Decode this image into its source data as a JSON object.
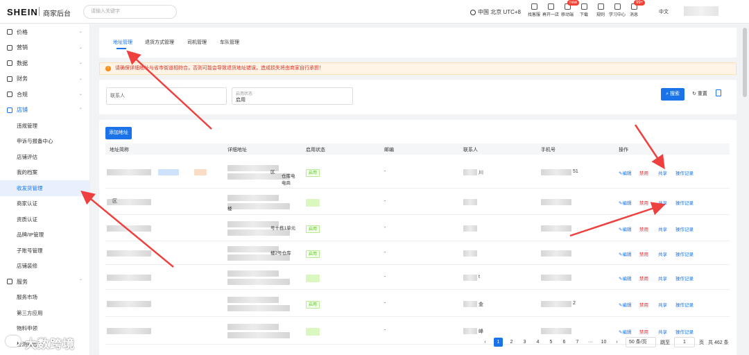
{
  "header": {
    "logo": "SHEIN",
    "subtitle": "商家后台",
    "search_placeholder": "请输入关键字",
    "region": "中国 北京 UTC+8",
    "tools": [
      {
        "label": "找客服",
        "badge": ""
      },
      {
        "label": "再开一店",
        "badge": ""
      },
      {
        "label": "移动端",
        "badge": "new"
      },
      {
        "label": "下载",
        "badge": ""
      },
      {
        "label": "规则",
        "badge": ""
      },
      {
        "label": "学习中心",
        "badge": ""
      },
      {
        "label": "消息",
        "badge": "99+"
      }
    ],
    "language": "中文"
  },
  "sidebar": {
    "groups": [
      {
        "label": "价格",
        "icon": "price-icon"
      },
      {
        "label": "营销",
        "icon": "marketing-icon"
      },
      {
        "label": "数据",
        "icon": "data-icon"
      },
      {
        "label": "财务",
        "icon": "finance-icon"
      },
      {
        "label": "合规",
        "icon": "shield-icon"
      },
      {
        "label": "店铺",
        "icon": "store-icon"
      }
    ],
    "store_items": [
      "违规管理",
      "申诉与报备中心",
      "店铺评估",
      "我的档案",
      "收发货管理",
      "商家认证",
      "资质认证",
      "品牌/IP管理",
      "子账号管理",
      "店铺装修"
    ],
    "service_group": "服务",
    "service_items": [
      "服务市场",
      "第三方应用",
      "物料申领",
      "检测报告"
    ]
  },
  "tabs": [
    "地址管理",
    "退货方式管理",
    "司机管理",
    "车队管理"
  ],
  "notice": "请确保详细地址与省市街道相符合，否则可能会导致退货地址错误，造成损失将由商家自行承担！",
  "filter": {
    "contact_placeholder": "联系人",
    "status_label": "启用状态",
    "status_value": "启用",
    "search_button": "搜索",
    "reset_button": "重置"
  },
  "table": {
    "add_button": "添加地址",
    "columns": [
      "地址简称",
      "详细地址",
      "启用状态",
      "邮编",
      "联系人",
      "手机号",
      "操作"
    ],
    "rows": [
      {
        "status": "启用",
        "zip": "-",
        "addr_fragment": "区",
        "addr_fragment2": "仓库电",
        "addr_fragment3": "电商",
        "phone_fragment": "51",
        "contact_fragment": "川"
      },
      {
        "status": "",
        "zip": "-",
        "addr_fragment": "楼",
        "name_fragment": "区"
      },
      {
        "status": "启用",
        "zip": "-",
        "addr_fragment": "号十栋1单元"
      },
      {
        "status": "启用",
        "zip": "-",
        "addr_fragment": "楼2号仓库"
      },
      {
        "status": "",
        "zip": "-",
        "contact_fragment": "t"
      },
      {
        "status": "启用",
        "zip": "-",
        "contact_fragment": "金",
        "phone_fragment": "2"
      },
      {
        "status": "",
        "zip": "-",
        "contact_fragment": "峰"
      }
    ],
    "actions": {
      "edit": "编辑",
      "disable": "禁用",
      "share": "共享",
      "log": "操作记录"
    }
  },
  "pagination": {
    "pages": [
      "1",
      "2",
      "3",
      "4",
      "5",
      "6",
      "7",
      "···",
      "10"
    ],
    "current": "1",
    "page_size": "50 条/页",
    "jump_label": "跳至",
    "jump_value": "1",
    "page_unit": "页",
    "total": "共 462 条"
  },
  "watermark": "大数跨境"
}
